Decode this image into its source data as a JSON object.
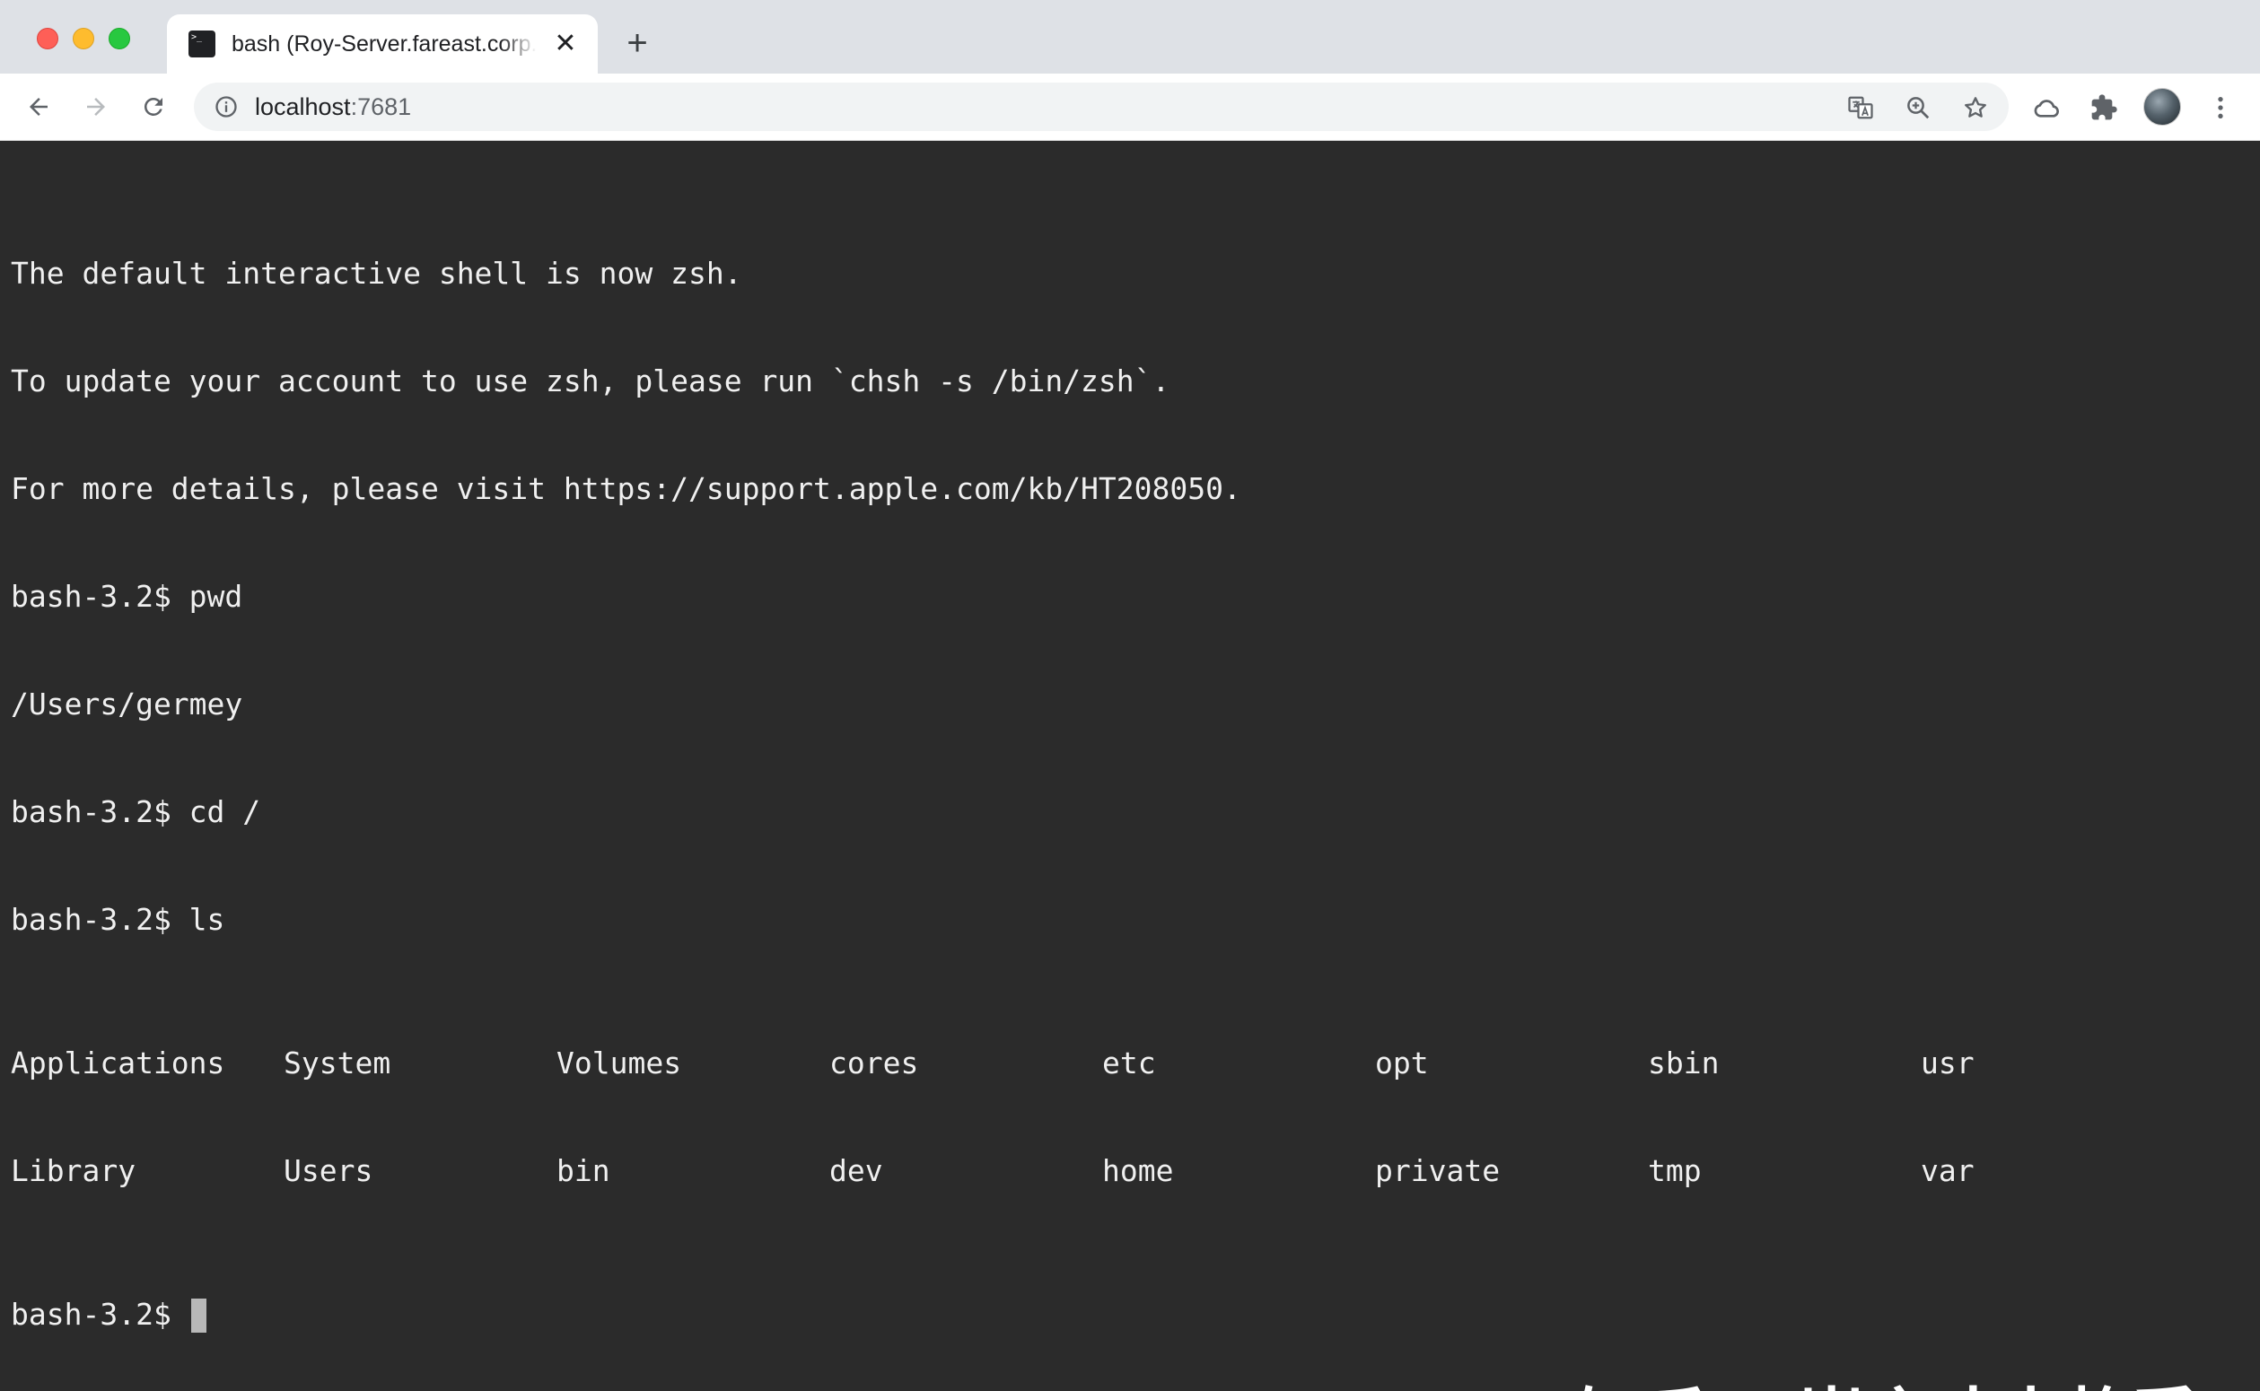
{
  "browser": {
    "tab": {
      "title": "bash (Roy-Server.fareast.corp.microsoft.com)",
      "favicon": "terminal-icon",
      "close_label": "✕"
    },
    "new_tab_label": "+",
    "url_host": "localhost",
    "url_port": ":7681",
    "icons": [
      "back-icon",
      "forward-icon",
      "reload-icon",
      "info-icon",
      "translate-icon",
      "zoom-icon",
      "bookmark-star-icon",
      "cloud-icon",
      "extensions-icon",
      "profile-avatar",
      "menu-icon"
    ]
  },
  "terminal": {
    "lines": [
      "",
      "The default interactive shell is now zsh.",
      "To update your account to use zsh, please run `chsh -s /bin/zsh`.",
      "For more details, please visit https://support.apple.com/kb/HT208050.",
      "bash-3.2$ pwd",
      "/Users/germey",
      "bash-3.2$ cd /",
      "bash-3.2$ ls"
    ],
    "ls_rows": [
      [
        "Applications",
        "System",
        "Volumes",
        "cores",
        "etc",
        "opt",
        "sbin",
        "usr"
      ],
      [
        "Library",
        "Users",
        "bin",
        "dev",
        "home",
        "private",
        "tmp",
        "var"
      ]
    ],
    "prompt": "bash-3.2$ ",
    "background": "#2b2b2b",
    "foreground": "#f0f0f0"
  },
  "watermark": "知乎 @崔庆才丨静觅"
}
